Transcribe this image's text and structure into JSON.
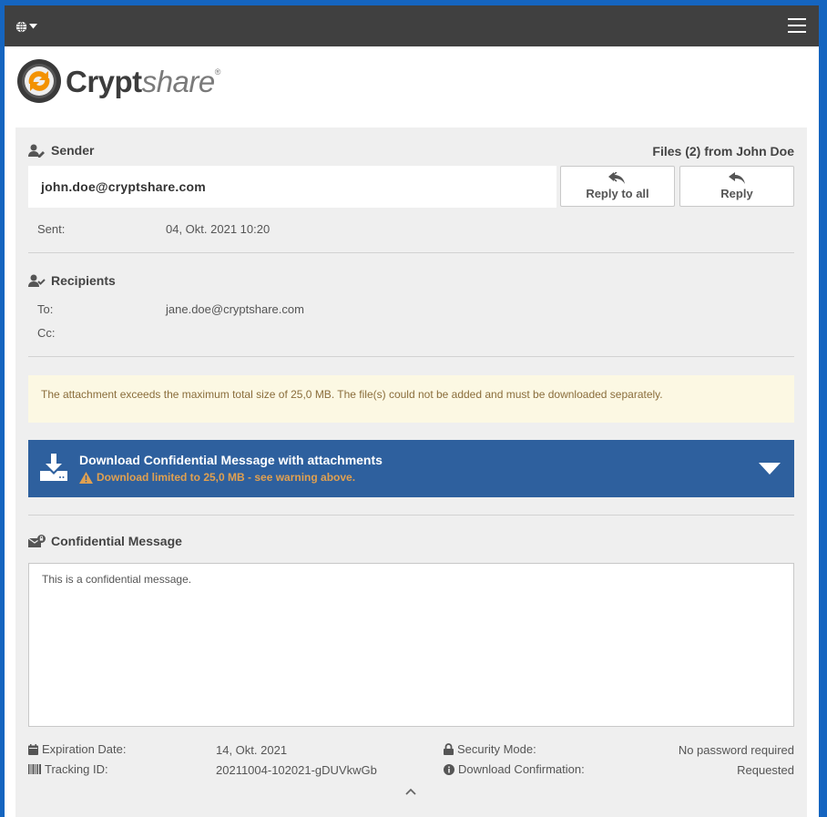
{
  "topbar": {
    "language_icon": "globe-icon",
    "menu_icon": "hamburger-icon"
  },
  "logo": {
    "crypt": "Crypt",
    "share": "share",
    "reg": "®"
  },
  "sender": {
    "heading": "Sender",
    "files_heading": "Files (2) from John Doe",
    "email": "john.doe@cryptshare.com",
    "reply_all_label": "Reply to all",
    "reply_label": "Reply",
    "sent_label": "Sent:",
    "sent_value": "04, Okt. 2021 10:20"
  },
  "recipients": {
    "heading": "Recipients",
    "to_label": "To:",
    "to_value": "jane.doe@cryptshare.com",
    "cc_label": "Cc:",
    "cc_value": ""
  },
  "warning": {
    "text": "The attachment exceeds the maximum total size of 25,0 MB. The file(s) could not be added and must be downloaded separately."
  },
  "download": {
    "title": "Download Confidential Message with attachments",
    "subtitle": "Download limited to 25,0 MB - see warning above.",
    "accent_color": "#2e609e",
    "warning_color": "#e0a050"
  },
  "message": {
    "heading": "Confidential Message",
    "body": "This is a confidential message."
  },
  "footer": {
    "expiration_label": "Expiration Date:",
    "expiration_value": "14, Okt. 2021",
    "tracking_label": "Tracking ID:",
    "tracking_value": "20211004-102021-gDUVkwGb",
    "security_label": "Security Mode:",
    "security_value": "No password required",
    "confirmation_label": "Download Confirmation:",
    "confirmation_value": "Requested"
  }
}
